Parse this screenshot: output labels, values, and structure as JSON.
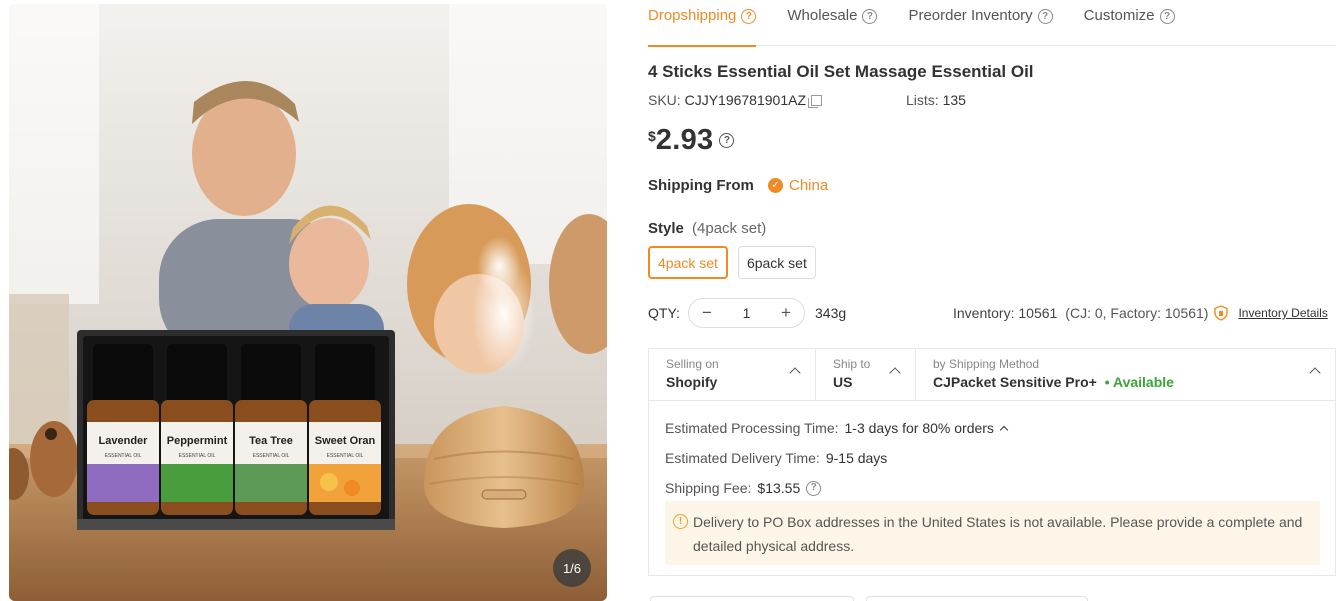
{
  "gallery": {
    "counter": "1/6",
    "bottle_labels": [
      "Lavender",
      "Peppermint",
      "Tea Tree",
      "Sweet Oran"
    ],
    "bottle_sublabel": "ESSENTIAL OIL"
  },
  "tabs": [
    {
      "label": "Dropshipping",
      "active": true
    },
    {
      "label": "Wholesale",
      "active": false
    },
    {
      "label": "Preorder Inventory",
      "active": false
    },
    {
      "label": "Customize",
      "active": false
    }
  ],
  "product": {
    "title": "4 Sticks Essential Oil Set Massage Essential Oil",
    "sku_label": "SKU:",
    "sku": "CJJY196781901AZ",
    "lists_label": "Lists:",
    "lists": "135",
    "currency": "$",
    "price": "2.93"
  },
  "shipping_from": {
    "label": "Shipping From",
    "country": "China"
  },
  "style": {
    "label": "Style",
    "selected": "(4pack set)",
    "options": [
      {
        "label": "4pack set",
        "active": true
      },
      {
        "label": "6pack set",
        "active": false
      }
    ]
  },
  "quantity": {
    "label": "QTY:",
    "minus": "−",
    "value": "1",
    "plus": "+",
    "weight": "343g"
  },
  "inventory": {
    "text": "Inventory: 10561",
    "breakdown": "(CJ: 0, Factory: 10561)",
    "link": "Inventory Details"
  },
  "shipping": {
    "selling_on": {
      "caption": "Selling on",
      "value": "Shopify"
    },
    "ship_to": {
      "caption": "Ship to",
      "value": "US"
    },
    "method": {
      "caption": "by Shipping Method",
      "value": "CJPacket Sensitive Pro+",
      "status": "• Available"
    },
    "processing": {
      "label": "Estimated Processing Time:",
      "value": "1-3 days for 80% orders"
    },
    "delivery": {
      "label": "Estimated Delivery Time:",
      "value": "9-15 days"
    },
    "fee": {
      "label": "Shipping Fee:",
      "value": "$13.55"
    },
    "notice": "Delivery to PO Box addresses in the United States is not available. Please provide a complete and detailed physical address."
  },
  "colors": {
    "accent": "#f08a24",
    "available": "#3ba33b",
    "notice_bg": "#fdf6e8"
  }
}
